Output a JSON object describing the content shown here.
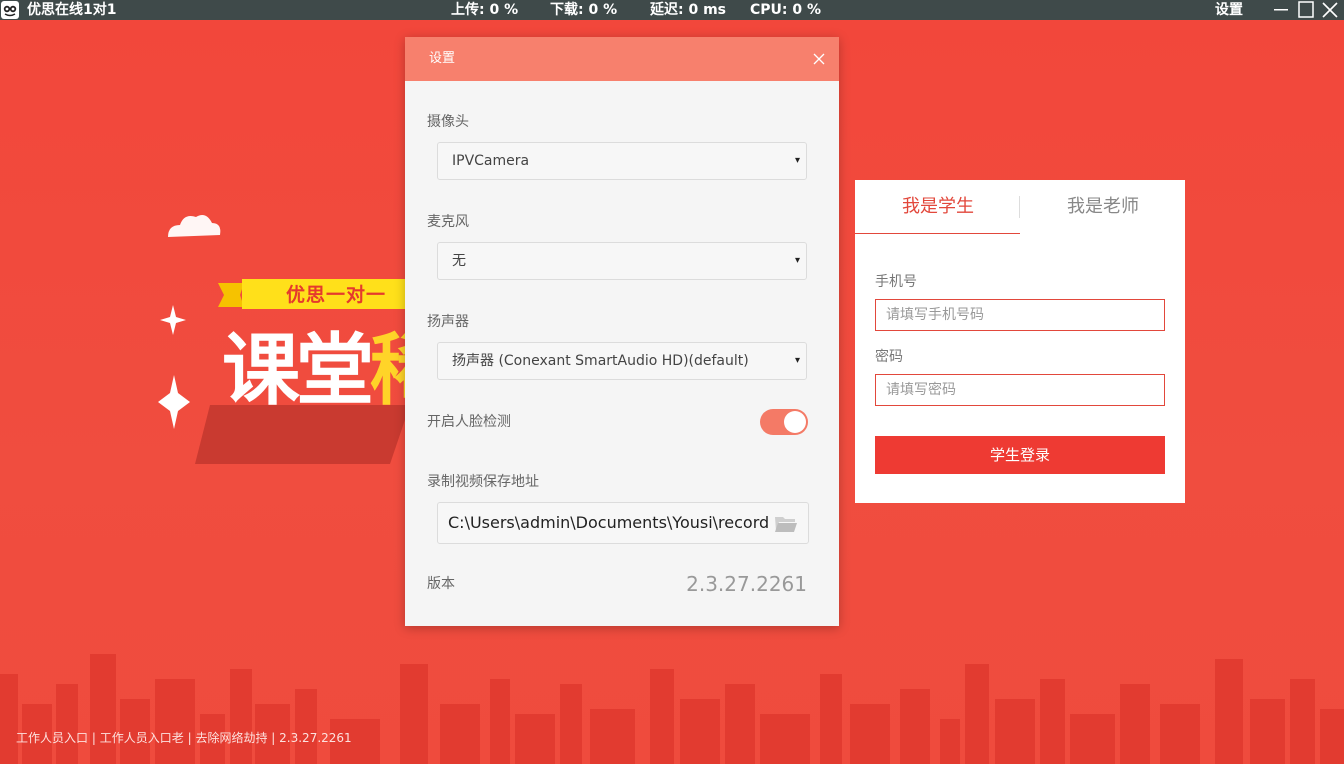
{
  "titlebar": {
    "app_title": "优思在线1对1",
    "upload": "上传: 0 %",
    "download": "下载: 0 %",
    "latency": "延迟: 0 ms",
    "cpu": "CPU: 0 %",
    "settings": "设置",
    "icons": [
      "app-logo-icon",
      "minimize-icon",
      "maximize-icon",
      "close-icon"
    ]
  },
  "hero": {
    "banner": "优思一对一",
    "headline_white": "课堂",
    "headline_yellow": "稀"
  },
  "settings_dialog": {
    "title": "设置",
    "camera": {
      "label": "摄像头",
      "value": "IPVCamera"
    },
    "microphone": {
      "label": "麦克风",
      "value": "无"
    },
    "speaker": {
      "label": "扬声器",
      "value": "扬声器 (Conexant SmartAudio HD)(default)"
    },
    "face_detection": {
      "label": "开启人脸检测",
      "enabled": true
    },
    "record_path": {
      "label": "录制视频保存地址",
      "value": "C:\\Users\\admin\\Documents\\Yousi\\record"
    },
    "version": {
      "label": "版本",
      "value": "2.3.27.2261"
    },
    "select_arrow": "▾"
  },
  "login": {
    "tab_student": "我是学生",
    "tab_teacher": "我是老师",
    "phone_label": "手机号",
    "phone_placeholder": "请填写手机号码",
    "password_label": "密码",
    "password_placeholder": "请填写密码",
    "submit": "学生登录"
  },
  "footer": {
    "link1": "工作人员入口",
    "link2": "工作人员入口老",
    "link3": "去除网络劫持",
    "version": "2.3.27.2261",
    "separator": "|"
  },
  "colors": {
    "background": "#f04a3c",
    "titlebar": "#3f4a4a",
    "dialog_header": "#f7806d",
    "accent": "#e2473b",
    "login_button": "#ee3a33",
    "toggle_on": "#f47a66"
  }
}
